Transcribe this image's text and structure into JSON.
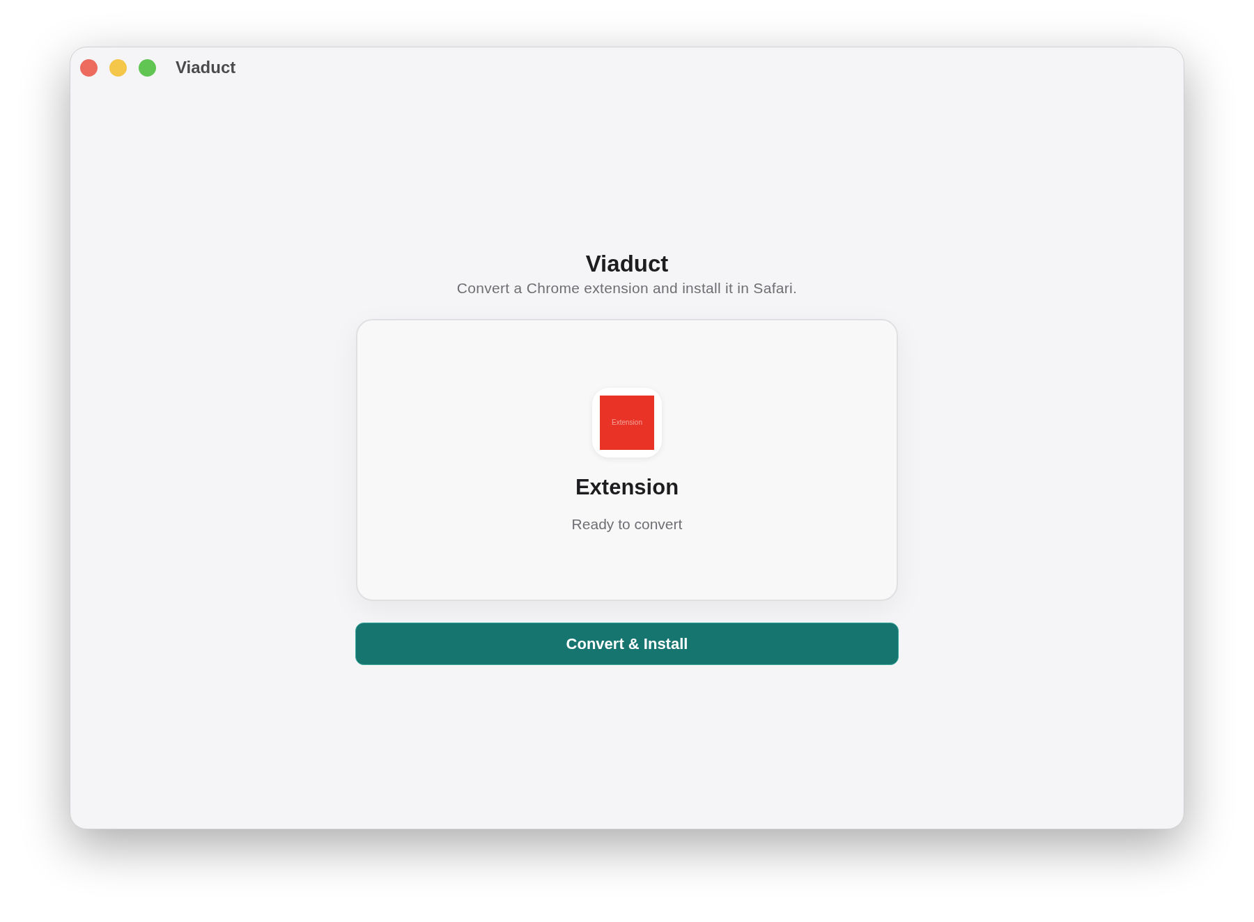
{
  "window": {
    "title": "Viaduct"
  },
  "header": {
    "title": "Viaduct",
    "subtitle": "Convert a Chrome extension and install it in Safari."
  },
  "extension_card": {
    "icon_label": "Extension",
    "name": "Extension",
    "status": "Ready to convert"
  },
  "primary_button": {
    "label": "Convert & Install"
  }
}
